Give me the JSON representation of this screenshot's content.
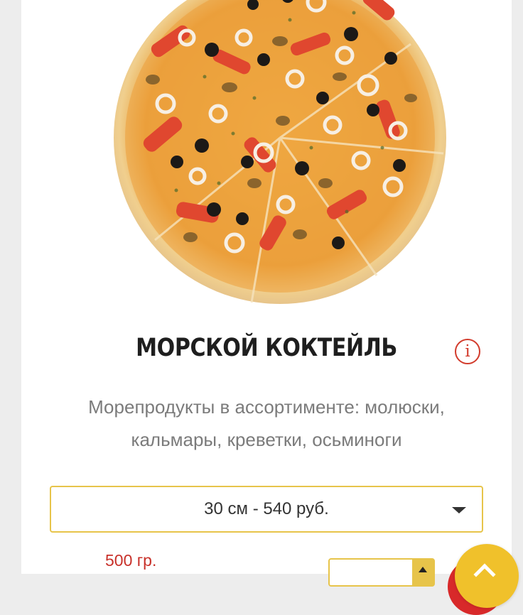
{
  "product": {
    "name": "МОРСКОЙ КОКТЕЙЛЬ",
    "description": "Морепродукты в ассортименте: молюски, кальмары, креветки, осьминоги",
    "image_alt": "pizza-image",
    "info_icon": "info-icon",
    "weight": "500 гр."
  },
  "size_select": {
    "selected": "30 см - 540 руб."
  },
  "icons": {
    "dropdown": "chevron-down-icon",
    "quantity_up": "chevron-up-icon",
    "scroll_top": "chevron-up-icon"
  },
  "colors": {
    "accent_yellow": "#e7c44a",
    "accent_red": "#d23b2c",
    "scroll_button": "#f0c12b",
    "text_dark": "#1e1e1e",
    "text_muted": "#7b7b7b"
  }
}
